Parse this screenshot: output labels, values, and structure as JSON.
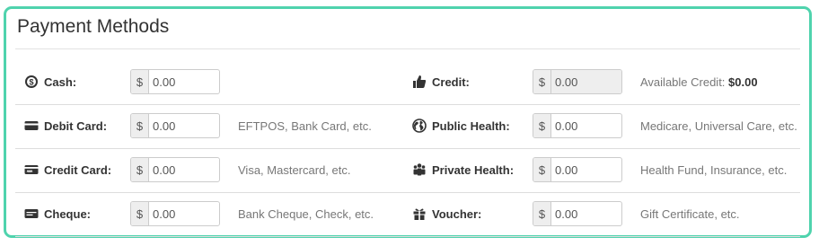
{
  "panel": {
    "title": "Payment Methods"
  },
  "currency_symbol": "$",
  "methods": {
    "cash": {
      "label": "Cash:",
      "value": "0.00",
      "icon": "cash-coin-icon"
    },
    "credit": {
      "label": "Credit:",
      "value": "0.00",
      "icon": "thumbs-up-icon",
      "hint_label": "Available Credit:",
      "hint_value": "$0.00"
    },
    "debit_card": {
      "label": "Debit Card:",
      "value": "0.00",
      "icon": "card-icon",
      "hint": "EFTPOS, Bank Card, etc."
    },
    "public_health": {
      "label": "Public Health:",
      "value": "0.00",
      "icon": "globe-icon",
      "hint": "Medicare, Universal Care, etc."
    },
    "credit_card": {
      "label": "Credit Card:",
      "value": "0.00",
      "icon": "credit-card-icon",
      "hint": "Visa, Mastercard, etc."
    },
    "private_health": {
      "label": "Private Health:",
      "value": "0.00",
      "icon": "group-icon",
      "hint": "Health Fund, Insurance, etc."
    },
    "cheque": {
      "label": "Cheque:",
      "value": "0.00",
      "icon": "cheque-icon",
      "hint": "Bank Cheque, Check, etc."
    },
    "voucher": {
      "label": "Voucher:",
      "value": "0.00",
      "icon": "gift-icon",
      "hint": "Gift Certificate, etc."
    }
  },
  "colors": {
    "panel_border": "#4fd3ad",
    "row_divider": "#dddddd",
    "hint_text": "#777777"
  }
}
